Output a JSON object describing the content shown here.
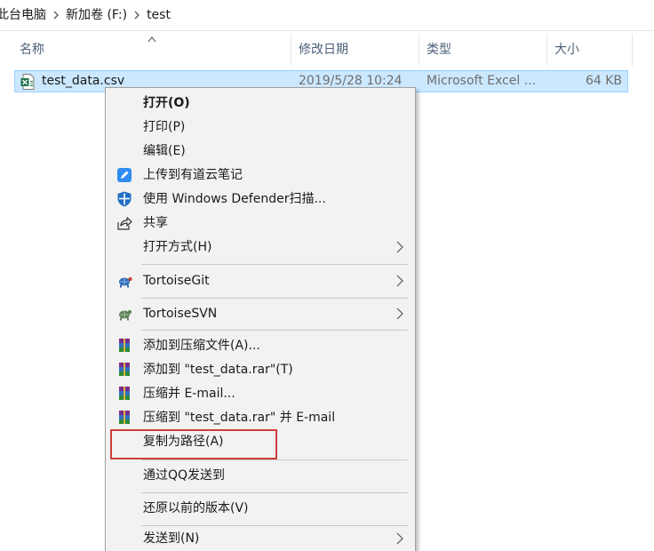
{
  "breadcrumb": {
    "items": [
      "此台电脑",
      "新加卷 (F:)",
      "test"
    ]
  },
  "columns": {
    "name": "名称",
    "date": "修改日期",
    "type": "类型",
    "size": "大小"
  },
  "file": {
    "name": "test_data.csv",
    "date": "2019/5/28 10:24",
    "type": "Microsoft Excel ...",
    "size": "64 KB"
  },
  "menu": {
    "open": "打开(O)",
    "print": "打印(P)",
    "edit": "编辑(E)",
    "upload_youdao": "上传到有道云笔记",
    "defender": "使用 Windows Defender扫描...",
    "share": "共享",
    "open_with": "打开方式(H)",
    "tortoisegit": "TortoiseGit",
    "tortoisesvn": "TortoiseSVN",
    "add_archive": "添加到压缩文件(A)...",
    "add_to_rar": "添加到 \"test_data.rar\"(T)",
    "compress_email": "压缩并 E-mail...",
    "compress_rar_email": "压缩到 \"test_data.rar\" 并 E-mail",
    "copy_path": "复制为路径(A)",
    "send_qq": "通过QQ发送到",
    "restore_versions": "还原以前的版本(V)",
    "send_to": "发送到(N)"
  },
  "colors": {
    "selection_bg": "#cce8ff",
    "selection_border": "#99d1ff",
    "menu_bg": "#f2f2f2",
    "highlight_box": "#d23c3c"
  }
}
